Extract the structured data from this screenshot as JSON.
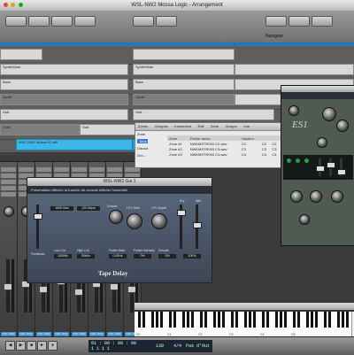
{
  "window": {
    "title": "WSL-NW2 Mossa Logic - Arrangement"
  },
  "toolbar": {
    "right_label": "Navigate"
  },
  "tracks": [
    {
      "regions": [
        {
          "label": "",
          "style": "light"
        },
        {
          "label": "",
          "style": "light"
        }
      ]
    },
    {
      "regions": [
        {
          "label": "Synth/Mute",
          "style": "light"
        },
        {
          "label": "Synth/Mute",
          "style": "light"
        },
        {
          "label": "",
          "style": "light"
        }
      ]
    },
    {
      "regions": [
        {
          "label": "Bass",
          "style": "light"
        },
        {
          "label": "Bass",
          "style": "light"
        },
        {
          "label": "",
          "style": "light"
        }
      ]
    },
    {
      "regions": [
        {
          "label": "Synth",
          "style": "gray"
        },
        {
          "label": "Synth",
          "style": "gray"
        },
        {
          "label": "",
          "style": "light"
        }
      ]
    },
    {
      "regions": [
        {
          "label": "Guit",
          "style": "light"
        },
        {
          "label": "Guit",
          "style": "light"
        }
      ]
    },
    {
      "regions": [
        {
          "label": "Lead",
          "style": "gray"
        },
        {
          "label": "Guit",
          "style": "light"
        }
      ]
    },
    {
      "regions": [
        {
          "label": "WSL-NW2 Mossa 02.aiff",
          "style": "blue"
        },
        {
          "label": "WSL-NW2 Mossa 02.aiff",
          "style": "blue"
        }
      ]
    }
  ],
  "browser": {
    "tabs": [
      "Zones",
      "Groupes",
      "Instrument",
      "Édit",
      "Zone",
      "Groupe",
      "Vue"
    ],
    "side": [
      "Zone",
      "Tous",
      "Discod",
      "Gro..."
    ],
    "headers": [
      "Zone",
      "Fichier audio",
      "Hauteur",
      "",
      ""
    ],
    "rows": [
      [
        "Zone #1",
        "NWKMSTR003 C2.wav",
        "C2",
        "C2",
        "C2"
      ],
      [
        "Zone #2",
        "NWKMSTR003 C3.wav",
        "C3",
        "C3",
        "C3"
      ],
      [
        "Zone #3",
        "NWKMSTR003 C4.wav",
        "C4",
        "C4",
        "C4"
      ]
    ]
  },
  "tape": {
    "title": "WSL-NW2 Gui 1",
    "menu": "Présentation   Afficher la tranche de console   Afficher l'essentiel",
    "knobs": [
      "Groove",
      "LFO Rate",
      "LFO Depth"
    ],
    "values": [
      "1000.0ms",
      "120.0bpm",
      "1000Hz",
      "30kHz",
      "0.00Hz",
      "0%",
      "0%",
      "100%"
    ],
    "labels": [
      "Dry",
      "Wet",
      "Feedback",
      "Low Cut",
      "High Cut",
      "Flutter Rate",
      "Flutter Intensity",
      "Smooth"
    ],
    "name": "Tape Delay"
  },
  "synth": {
    "logo": "ES1"
  },
  "transport": {
    "time": "01 : 00 : 00 : 00",
    "bars": "1     1     1     1",
    "tempo": "130",
    "signature": "4/4",
    "mode": "Pas d'Out"
  },
  "keyboard": {
    "octaves": [
      "C0",
      "C1",
      "C2",
      "C3",
      "C4",
      "C5"
    ]
  },
  "mixer": {
    "channels": [
      "WSL-NW2",
      "WSL-NW2",
      "WSL-NW2",
      "WSL-NW2",
      "WSL-NW2",
      "WSL-NW2",
      "WSL-NW2",
      "WSL-NW2"
    ],
    "levels": [
      0.55,
      0.6,
      0.5,
      0.65,
      0.45,
      0.6,
      0.55,
      0.5
    ]
  },
  "colors": {
    "accent": "#0d7bd0",
    "region_blue": "#3cb8e6"
  }
}
